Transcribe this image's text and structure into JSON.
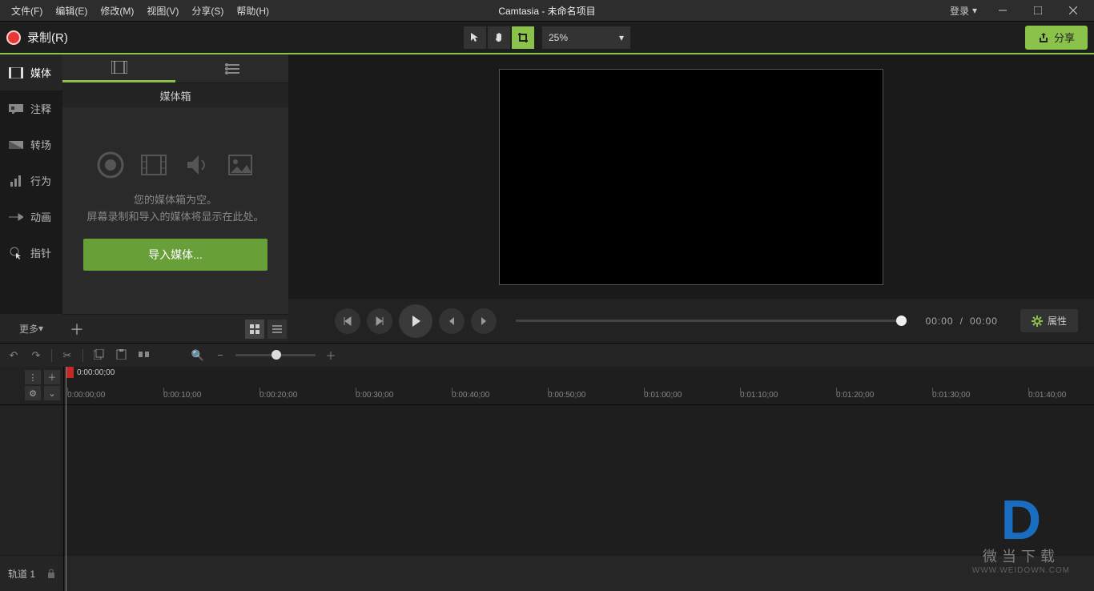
{
  "menu": {
    "file": "文件(F)",
    "edit": "编辑(E)",
    "modify": "修改(M)",
    "view": "视图(V)",
    "share": "分享(S)",
    "help": "帮助(H)"
  },
  "title": "Camtasia - 未命名项目",
  "login": "登录",
  "record": "录制(R)",
  "zoom": "25%",
  "shareBtn": "分享",
  "sidebar": {
    "media": "媒体",
    "annot": "注释",
    "trans": "转场",
    "behav": "行为",
    "anim": "动画",
    "cursor": "指针",
    "more": "更多"
  },
  "mediaPanel": {
    "title": "媒体箱",
    "empty1": "您的媒体箱为空。",
    "empty2": "屏幕录制和导入的媒体将显示在此处。",
    "import": "导入媒体..."
  },
  "playback": {
    "cur": "00:00",
    "sep": "/",
    "dur": "00:00"
  },
  "props": "属性",
  "playheadTime": "0:00:00;00",
  "ruler": [
    "0:00:00;00",
    "0:00:10;00",
    "0:00:20;00",
    "0:00:30;00",
    "0:00:40;00",
    "0:00:50;00",
    "0:01:00;00",
    "0:01:10;00",
    "0:01:20;00",
    "0:01:30;00",
    "0:01:40;00"
  ],
  "track": "轨道 1",
  "watermark": {
    "t1": "微当下载",
    "t2": "WWW.WEIDOWN.COM"
  }
}
